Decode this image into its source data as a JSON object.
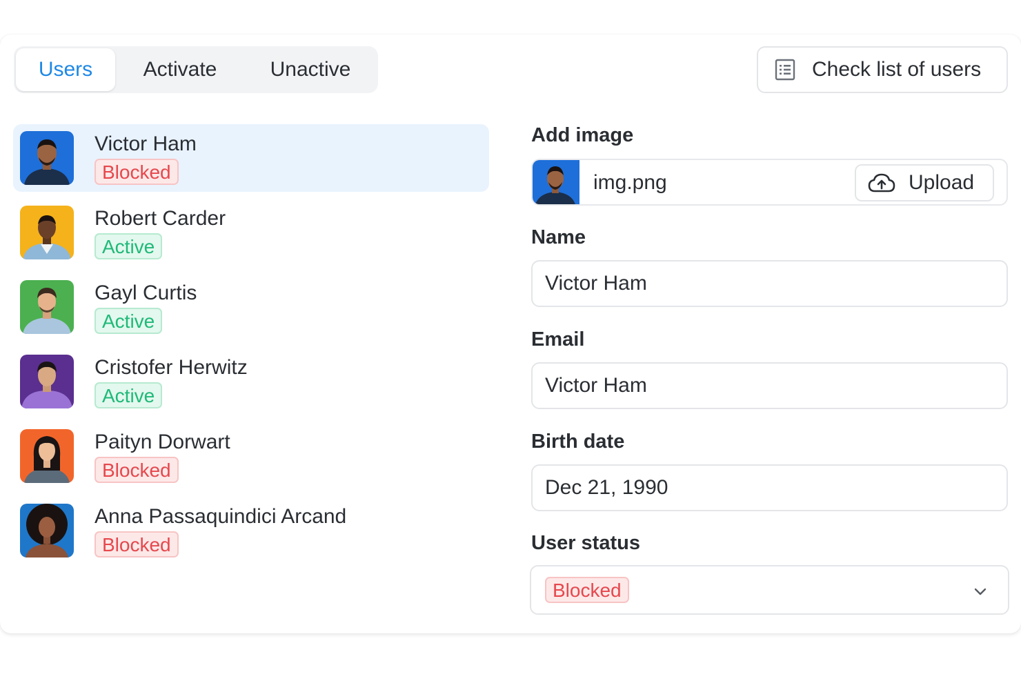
{
  "tabs": [
    {
      "label": "Users",
      "active": true
    },
    {
      "label": "Activate",
      "active": false
    },
    {
      "label": "Unactive",
      "active": false
    }
  ],
  "header": {
    "check_list_label": "Check list of users",
    "check_list_icon": "list-icon"
  },
  "users": [
    {
      "name": "Victor Ham",
      "status": "Blocked",
      "selected": true,
      "avatar_bg": "#1e6fd9"
    },
    {
      "name": "Robert Carder",
      "status": "Active",
      "selected": false,
      "avatar_bg": "#f5b21a"
    },
    {
      "name": "Gayl Curtis",
      "status": "Active",
      "selected": false,
      "avatar_bg": "#4cb050"
    },
    {
      "name": "Cristofer Herwitz",
      "status": "Active",
      "selected": false,
      "avatar_bg": "#5a2f8f"
    },
    {
      "name": "Paityn Dorwart",
      "status": "Blocked",
      "selected": false,
      "avatar_bg": "#f2652a"
    },
    {
      "name": "Anna Passaquindici Arcand",
      "status": "Blocked",
      "selected": false,
      "avatar_bg": "#1f77c9"
    }
  ],
  "form": {
    "add_image_label": "Add image",
    "file_name": "img.png",
    "upload_label": "Upload",
    "upload_icon": "cloud-upload-icon",
    "name_label": "Name",
    "name_value": "Victor Ham",
    "email_label": "Email",
    "email_value": "Victor Ham",
    "birth_label": "Birth date",
    "birth_value": "Dec 21, 1990",
    "status_label": "User status",
    "status_value": "Blocked",
    "status_icon": "chevron-down-icon"
  },
  "colors": {
    "accent": "#1e88e5",
    "selected_row": "#e9f3fe",
    "blocked_text": "#e5484d",
    "blocked_bg": "#fde8e8",
    "active_text": "#1fb978",
    "active_bg": "#e3f8ee"
  }
}
